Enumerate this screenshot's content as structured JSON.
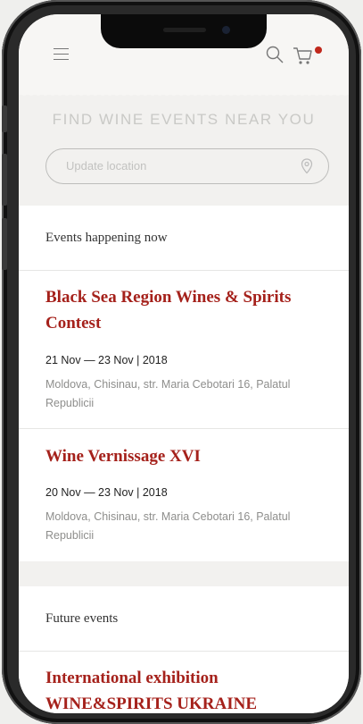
{
  "header": {
    "menu_icon": "hamburger-icon",
    "search_icon": "search-icon",
    "cart_icon": "cart-icon",
    "cart_badge_color": "#c0281c"
  },
  "search": {
    "title": "FIND WINE EVENTS NEAR YOU",
    "placeholder": "Update location",
    "location_icon": "map-pin-icon"
  },
  "sections": {
    "now": {
      "heading": "Events happening now",
      "events": [
        {
          "title": "Black Sea Region Wines & Spirits Contest",
          "dates": "21 Nov — 23 Nov | 2018",
          "location": "Moldova, Chisinau, str. Maria Cebotari 16, Palatul Republicii"
        },
        {
          "title": "Wine Vernissage XVI",
          "dates": "20 Nov — 23 Nov | 2018",
          "location": "Moldova, Chisinau, str. Maria Cebotari 16, Palatul Republicii"
        }
      ]
    },
    "future": {
      "heading": "Future events",
      "events": [
        {
          "title": "International exhibition WINE&SPIRITS UKRAINE"
        }
      ]
    }
  },
  "colors": {
    "accent": "#a5211b",
    "muted_text": "#8e8e8c",
    "page_bg": "#f2f1ef"
  }
}
